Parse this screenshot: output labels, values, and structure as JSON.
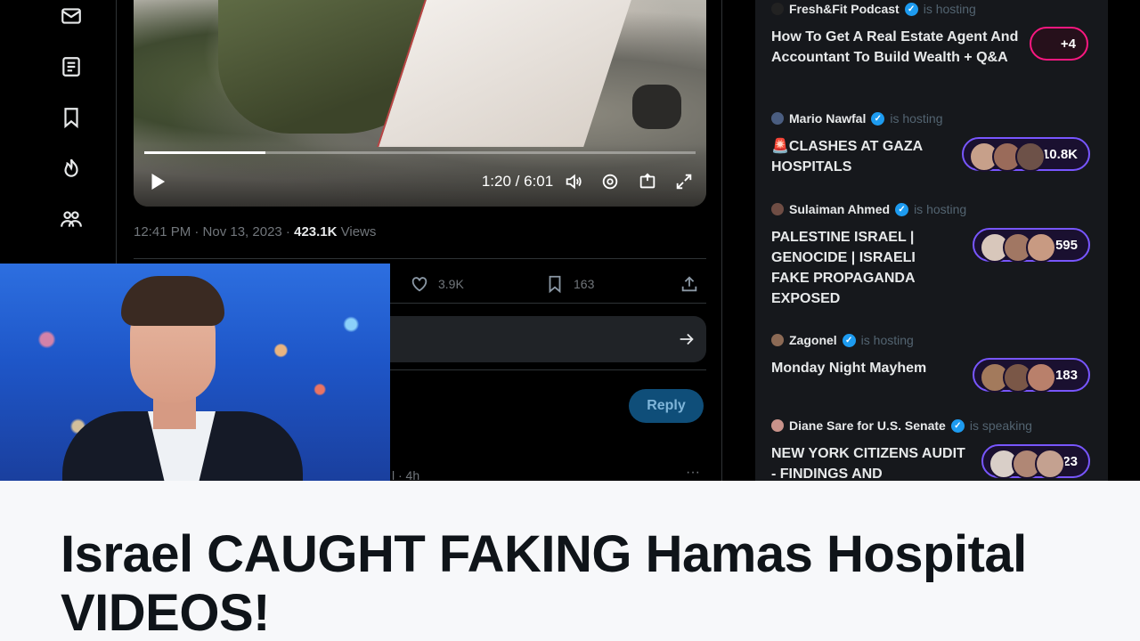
{
  "video": {
    "time": "1:20 / 6:01",
    "progress": 0.22
  },
  "tweet": {
    "timestamp": "12:41 PM · Nov 13, 2023 · ",
    "views_count": "423.1K",
    "views_label": " Views",
    "likes": "3.9K",
    "bookmarks": "163",
    "reply_button": "Reply",
    "next_meta": "l · 4h",
    "more": "···"
  },
  "spaces": [
    {
      "host": "Fresh&Fit Podcast",
      "role": "is hosting",
      "title": "How To Get A Real Estate Agent And Accountant To Build Wealth + Q&A",
      "listeners": "+4",
      "pill_color": "#f91880"
    },
    {
      "host": "Mario Nawfal",
      "role": "is hosting",
      "title": "🚨CLASHES AT GAZA HOSPITALS",
      "listeners": "+10.8K",
      "pill_color": "#7856ff"
    },
    {
      "host": "Sulaiman Ahmed",
      "role": "is hosting",
      "title": "PALESTINE ISRAEL | GENOCIDE | ISRAELI FAKE PROPAGANDA EXPOSED",
      "listeners": "+595",
      "pill_color": "#7856ff"
    },
    {
      "host": "Zagonel",
      "role": "is hosting",
      "title": "Monday Night Mayhem",
      "listeners": "+183",
      "pill_color": "#7856ff"
    },
    {
      "host": "Diane Sare for U.S. Senate",
      "role": "is speaking",
      "title": "NEW YORK CITIZENS AUDIT - FINDINGS AND",
      "listeners": "+23",
      "pill_color": "#7856ff"
    }
  ],
  "caption": {
    "title": "Israel CAUGHT FAKING Hamas Hospital VIDEOS!"
  },
  "icons": [
    "messages-icon",
    "lists-icon",
    "bookmarks-icon",
    "topics-icon",
    "communities-icon",
    "play-icon",
    "volume-icon",
    "settings-icon",
    "pip-icon",
    "fullscreen-icon",
    "like-icon",
    "bookmark-icon",
    "share-icon",
    "send-icon",
    "verified-icon"
  ]
}
